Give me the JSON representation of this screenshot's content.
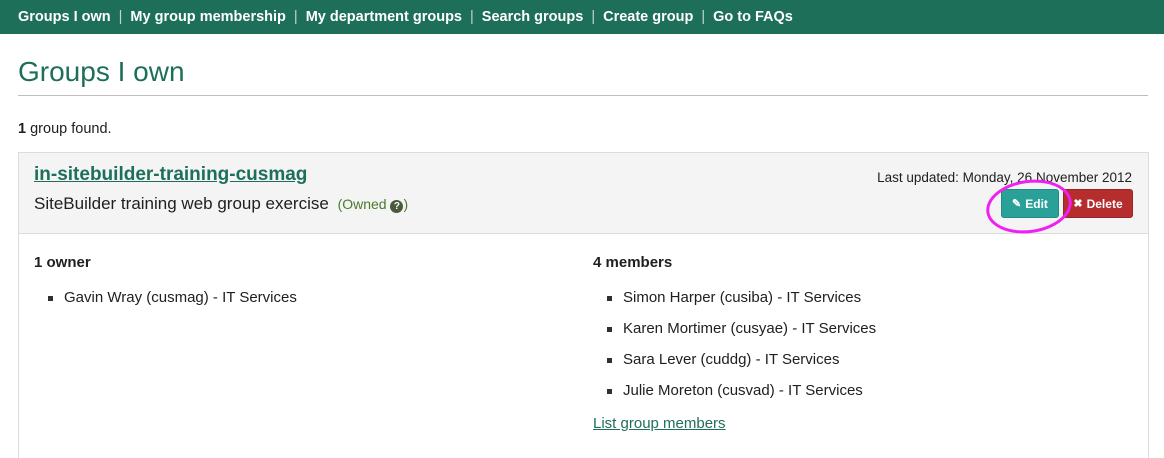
{
  "nav": {
    "items": [
      {
        "label": "Groups I own"
      },
      {
        "label": "My group membership"
      },
      {
        "label": "My department groups"
      },
      {
        "label": "Search groups"
      },
      {
        "label": "Create group"
      },
      {
        "label": "Go to FAQs"
      }
    ],
    "separator": "|"
  },
  "page": {
    "title": "Groups I own",
    "found_count": "1",
    "found_suffix": " group found."
  },
  "group": {
    "name": "in-sitebuilder-training-cusmag",
    "description": "SiteBuilder training web group exercise",
    "owned_open": "(Owned",
    "owned_close": ")",
    "last_updated": "Last updated: Monday, 26 November 2012",
    "edit_label": "Edit",
    "delete_label": "Delete",
    "owners_heading": "1 owner",
    "owners": [
      {
        "text": "Gavin Wray (cusmag) - IT Services"
      }
    ],
    "members_heading": "4 members",
    "members": [
      {
        "text": "Simon Harper (cusiba) - IT Services"
      },
      {
        "text": "Karen Mortimer (cusyae) - IT Services"
      },
      {
        "text": "Sara Lever (cuddg) - IT Services"
      },
      {
        "text": "Julie Moreton (cusvad) - IT Services"
      }
    ],
    "list_members_link": "List group members"
  },
  "icons": {
    "help": "question-circle-icon",
    "edit": "pencil-square-icon",
    "delete": "times-icon"
  },
  "colors": {
    "brand_green": "#1e6f5a",
    "edit_button": "#2aa198",
    "delete_button": "#b52d2d",
    "annotation": "#f020f0"
  }
}
